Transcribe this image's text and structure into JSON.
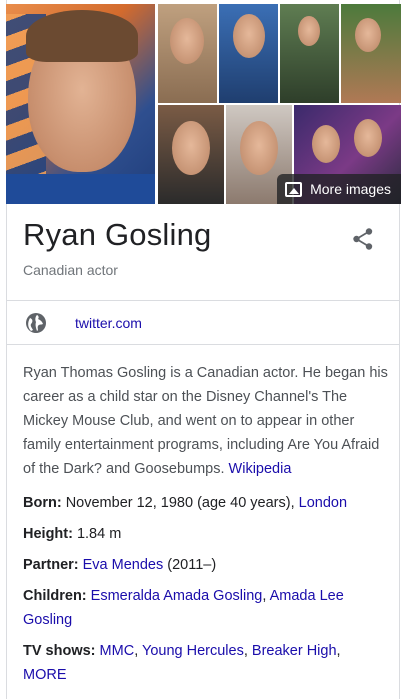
{
  "images": {
    "more_images_label": "More images"
  },
  "header": {
    "name": "Ryan Gosling",
    "subtitle": "Canadian actor"
  },
  "website": {
    "link": "twitter.com"
  },
  "description": {
    "text": "Ryan Thomas Gosling is a Canadian actor. He began his career as a child star on the Disney Channel's The Mickey Mouse Club, and went on to appear in other family entertainment programs, including Are You Afraid of the Dark? and Goosebumps.",
    "source_link": "Wikipedia"
  },
  "facts": {
    "born": {
      "label": "Born:",
      "value": "November 12, 1980 (age 40 years),",
      "link": "London"
    },
    "height": {
      "label": "Height:",
      "value": "1.84 m"
    },
    "partner": {
      "label": "Partner:",
      "link": "Eva Mendes",
      "value": "(2011–)"
    },
    "children": {
      "label": "Children:",
      "link1": "Esmeralda Amada Gosling",
      "sep": ",",
      "link2": "Amada Lee Gosling"
    },
    "tv_shows": {
      "label": "TV shows:",
      "link1": "MMC",
      "link2": "Young Hercules",
      "link3": "Breaker High",
      "sep": ",",
      "more": "MORE"
    }
  },
  "colors": {
    "link": "#1a0dab",
    "text": "#202124",
    "muted": "#70757a"
  }
}
